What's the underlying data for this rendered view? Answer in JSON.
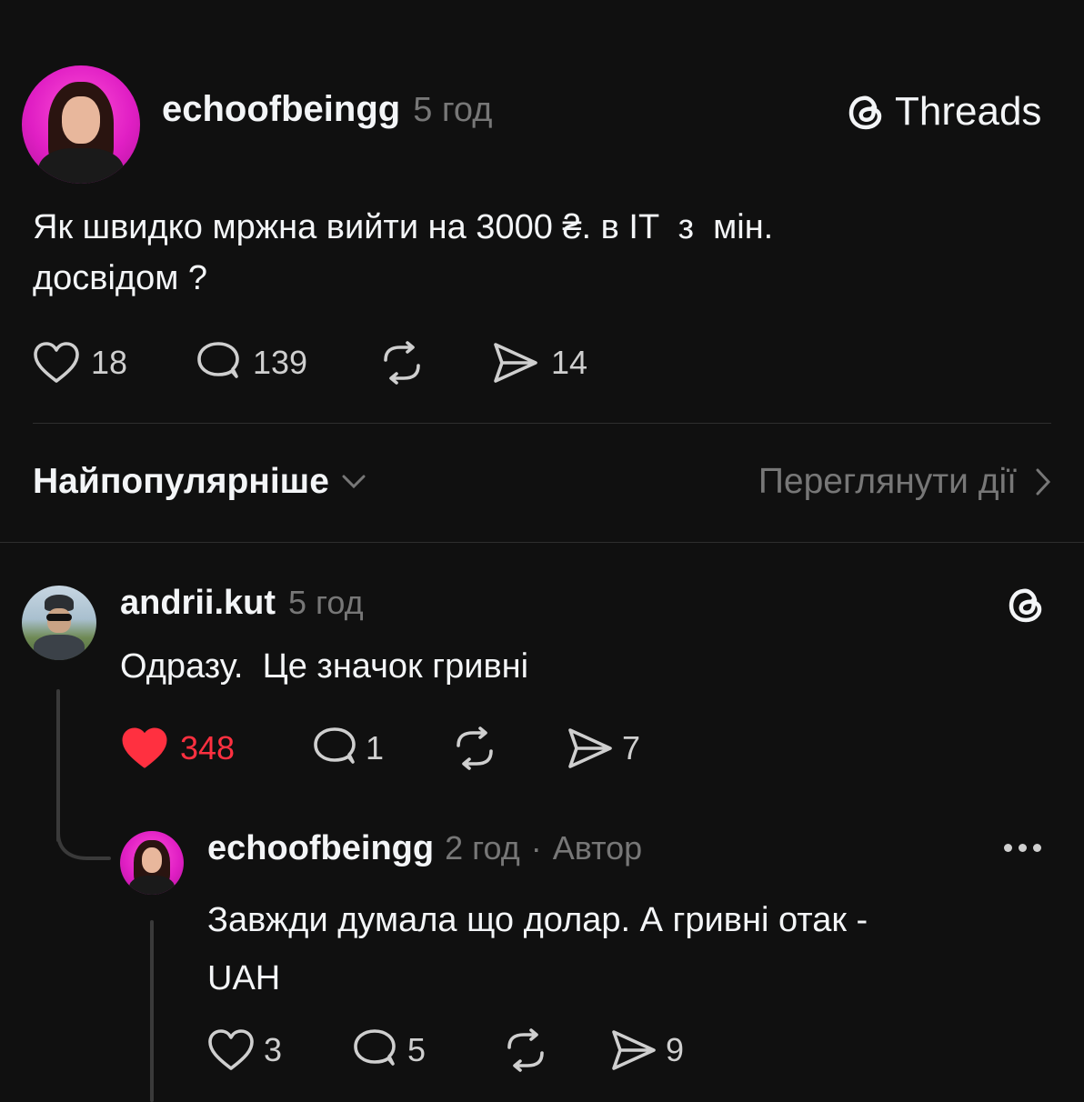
{
  "post": {
    "username": "echoofbeingg",
    "time": "5 год",
    "brand": "Threads",
    "text_line1": "Як швидко мржна вийти на 3000 ₴. в IT  з  мін.",
    "text_line2": "досвідом ?",
    "likes": "18",
    "replies": "139",
    "shares": "14"
  },
  "sort": {
    "label": "Найпопулярніше",
    "activity_label": "Переглянути дії"
  },
  "reply1": {
    "username": "andrii.kut",
    "time": "5 год",
    "text": "Одразу.  Це значок гривні",
    "likes": "348",
    "replies": "1",
    "shares": "7",
    "liked": true,
    "like_color": "#ff3040"
  },
  "reply2": {
    "username": "echoofbeingg",
    "time": "2 год",
    "separator": "·",
    "author_label": "Автор",
    "text_line1": "Завжди думала що долар. А гривні отак -",
    "text_line2": "UAH",
    "likes": "3",
    "replies": "5",
    "shares": "9"
  },
  "colors": {
    "background": "#101010",
    "text": "#f3f5f7",
    "muted": "#777777",
    "like_active": "#ff3040",
    "avatar_pink": "#e01fc4"
  }
}
